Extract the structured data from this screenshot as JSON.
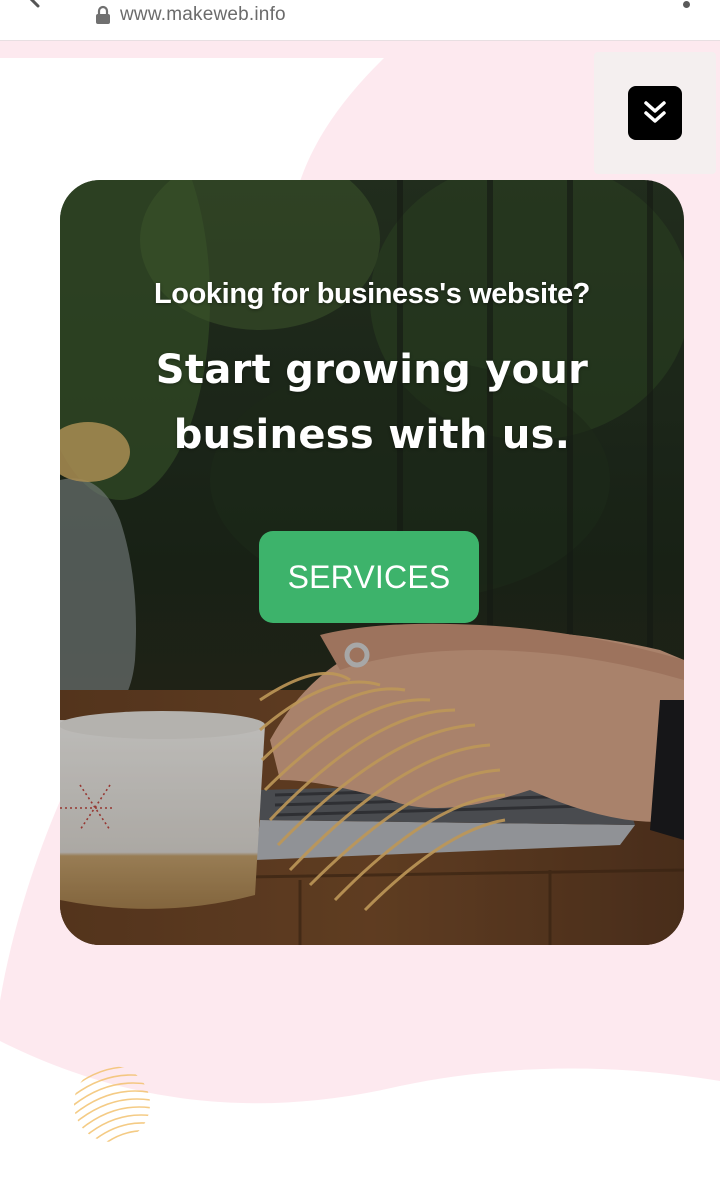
{
  "browser": {
    "url": "www.makeweb.info"
  },
  "icons": {
    "lock": "lock-icon",
    "toggle": "double-chevron-down-icon",
    "back": "back-arrow-icon",
    "menu": "more-vert-icon"
  },
  "colors": {
    "page_pink": "#fde9ef",
    "button_green": "#3db36b",
    "accent_orange": "#f3c270",
    "toggle_black": "#000000"
  },
  "hero": {
    "subtitle": "Looking for business's website?",
    "title": "Start growing your business with us.",
    "cta_label": "SERVICES"
  }
}
